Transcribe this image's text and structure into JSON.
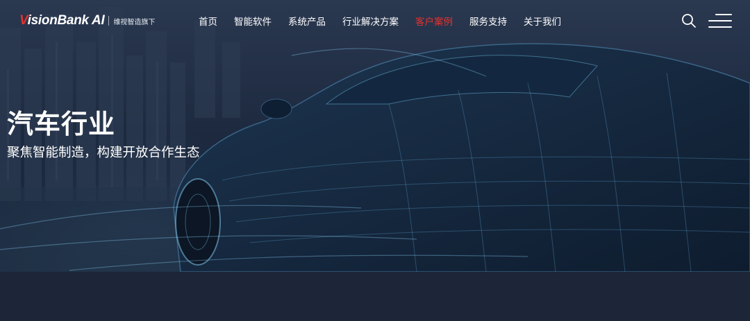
{
  "brand": {
    "logo_text": "VisionBank AI",
    "logo_subtext": "维视智造旗下",
    "accent_color": "#e5322d"
  },
  "nav": {
    "items": [
      {
        "label": "首页",
        "active": false
      },
      {
        "label": "智能软件",
        "active": false
      },
      {
        "label": "系统产品",
        "active": false
      },
      {
        "label": "行业解决方案",
        "active": false
      },
      {
        "label": "客户案例",
        "active": true
      },
      {
        "label": "服务支持",
        "active": false
      },
      {
        "label": "关于我们",
        "active": false
      }
    ],
    "search_icon": "search-icon",
    "menu_icon": "hamburger-icon"
  },
  "hero": {
    "title": "汽车行业",
    "subtitle": "聚焦智能制造，构建开放合作生态"
  }
}
